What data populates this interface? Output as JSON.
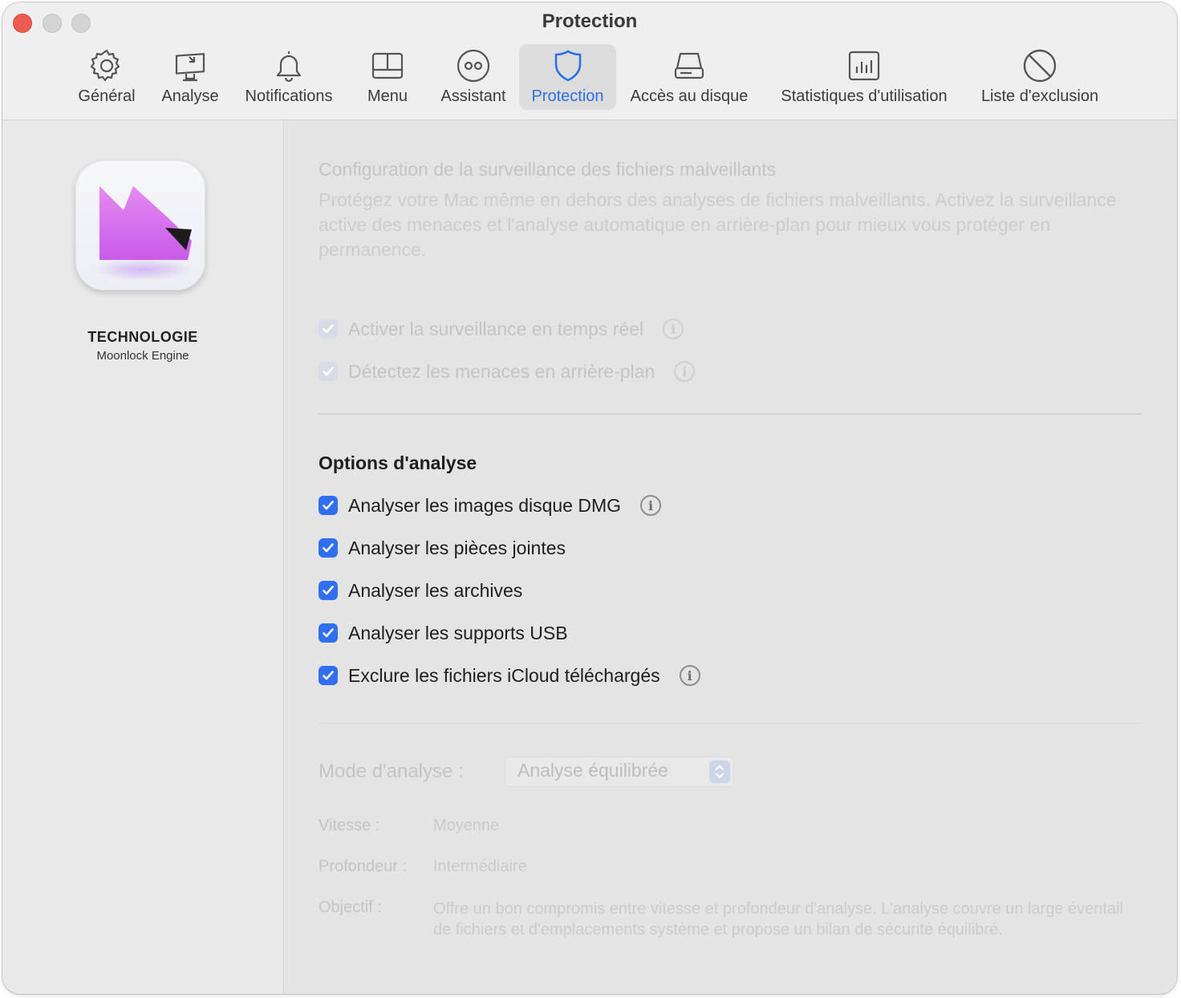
{
  "window": {
    "title": "Protection"
  },
  "toolbar": {
    "items": [
      {
        "label": "Général",
        "icon": "gear-icon"
      },
      {
        "label": "Analyse",
        "icon": "monitor-scan-icon"
      },
      {
        "label": "Notifications",
        "icon": "bell-icon"
      },
      {
        "label": "Menu",
        "icon": "menu-window-icon"
      },
      {
        "label": "Assistant",
        "icon": "assistant-face-icon"
      },
      {
        "label": "Protection",
        "icon": "shield-icon",
        "active": true
      },
      {
        "label": "Accès au disque",
        "icon": "disk-icon"
      },
      {
        "label": "Statistiques d'utilisation",
        "icon": "bar-chart-icon"
      },
      {
        "label": "Liste d'exclusion",
        "icon": "prohibited-icon"
      }
    ]
  },
  "sidebar": {
    "icon": "moonlock-app-icon",
    "title": "TECHNOLOGIE",
    "subtitle": "Moonlock Engine"
  },
  "monitoring": {
    "title": "Configuration de la surveillance des fichiers malveillants",
    "description": "Protégez votre Mac même en dehors des analyses de fichiers malveillants. Activez la surveillance active des menaces et l'analyse automatique en arrière-plan pour mieux vous protéger en permanence.",
    "options": [
      {
        "label": "Activer la surveillance en temps réel",
        "checked": true,
        "enabled": false,
        "info": true
      },
      {
        "label": "Détectez les menaces en arrière-plan",
        "checked": true,
        "enabled": false,
        "info": true
      }
    ]
  },
  "scan_options": {
    "title": "Options d'analyse",
    "options": [
      {
        "label": "Analyser les images disque DMG",
        "checked": true,
        "info": true
      },
      {
        "label": "Analyser les pièces jointes",
        "checked": true,
        "info": false
      },
      {
        "label": "Analyser les archives",
        "checked": true,
        "info": false
      },
      {
        "label": "Analyser les supports USB",
        "checked": true,
        "info": false
      },
      {
        "label": "Exclure les fichiers iCloud téléchargés",
        "checked": true,
        "info": true
      }
    ]
  },
  "scan_mode": {
    "label": "Mode d'analyse :",
    "selected": "Analyse équilibrée",
    "speed_label": "Vitesse :",
    "speed_value": "Moyenne",
    "depth_label": "Profondeur :",
    "depth_value": "Intermédiaire",
    "goal_label": "Objectif :",
    "goal_value": "Offre un bon compromis entre vitesse et profondeur d'analyse. L'analyse couvre un large éventail de fichiers et d'emplacements système et propose un bilan de sécurité équilibré."
  },
  "colors": {
    "accent": "#2f6ff0",
    "close_button": "#ee5b53",
    "app_icon_pink": "#e27bf0"
  }
}
